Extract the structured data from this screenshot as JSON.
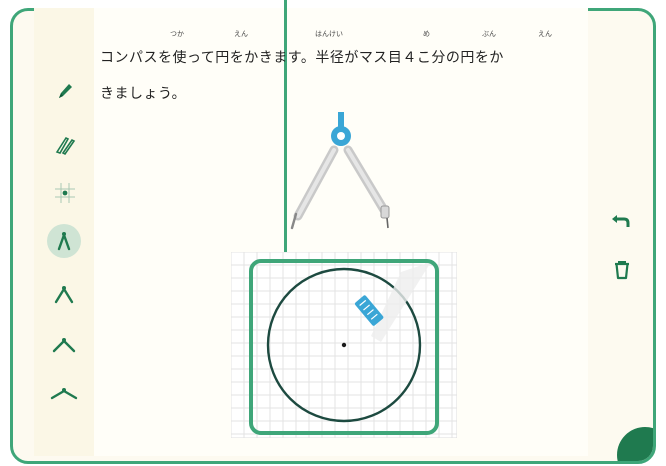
{
  "question": {
    "line1": "コンパスを使って円をかきます。半径がマス目４こ分の円をか",
    "line2": "きましょう。",
    "ruby": [
      "つか",
      "えん",
      "はんけい",
      "め",
      "ぶん",
      "えん"
    ]
  },
  "tools": [
    {
      "name": "pencil-tool",
      "icon": "pencil-icon",
      "active": false
    },
    {
      "name": "ruler-tool",
      "icon": "ruler-icon",
      "active": false
    },
    {
      "name": "grid-point-tool",
      "icon": "grid-point-icon",
      "active": false
    },
    {
      "name": "compass-narrow-tool",
      "icon": "compass-icon",
      "active": true
    },
    {
      "name": "compass-medium-tool",
      "icon": "compass-icon",
      "active": false
    },
    {
      "name": "compass-wide-tool",
      "icon": "compass-icon",
      "active": false
    },
    {
      "name": "compass-widest-tool",
      "icon": "compass-icon",
      "active": false
    }
  ],
  "side_actions": [
    {
      "name": "undo-button",
      "icon": "undo-icon"
    },
    {
      "name": "trash-button",
      "icon": "trash-icon"
    }
  ],
  "colors": {
    "accent": "#3fa679",
    "tool_green": "#1f7a4f",
    "compass_blue": "#3aa6d6",
    "circle": "#1d4a40"
  },
  "grid": {
    "radius_cells": 4
  }
}
